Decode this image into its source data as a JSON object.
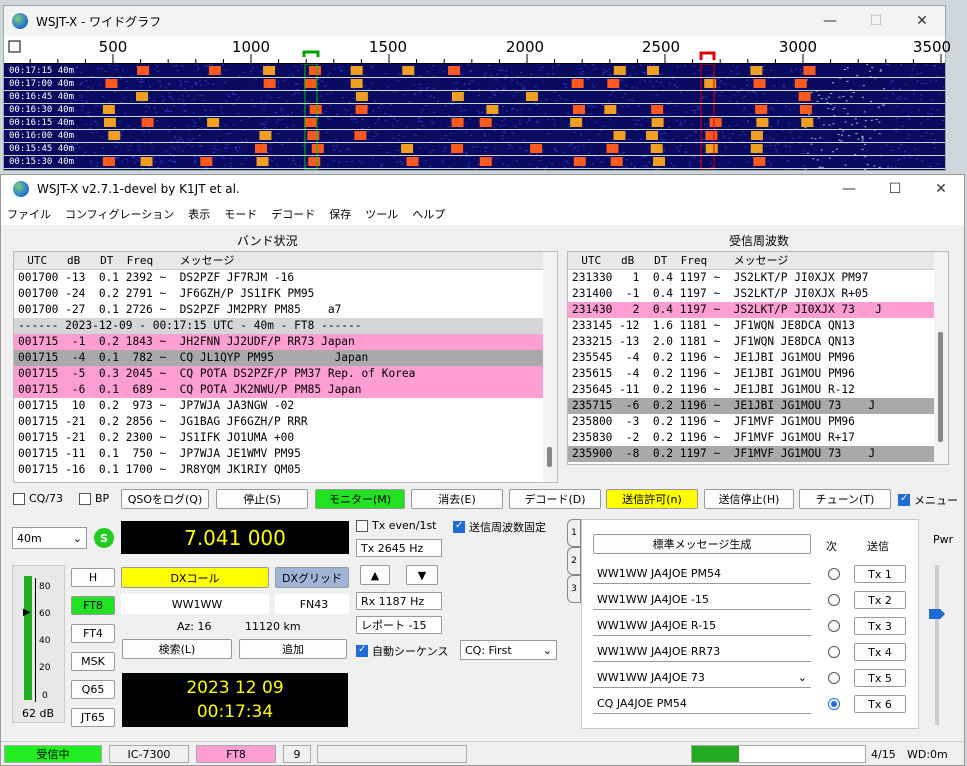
{
  "widegraph": {
    "title": "WSJT-X - ワイドグラフ",
    "scale_labels": [
      "500",
      "1000",
      "1500",
      "2000",
      "2500",
      "3000",
      "3500"
    ],
    "time_rows": [
      {
        "utc": "00:17:15",
        "band": "40m"
      },
      {
        "utc": "00:17:00",
        "band": "40m"
      },
      {
        "utc": "00:16:45",
        "band": "40m"
      },
      {
        "utc": "00:16:30",
        "band": "40m"
      },
      {
        "utc": "00:16:15",
        "band": "40m"
      },
      {
        "utc": "00:16:00",
        "band": "40m"
      },
      {
        "utc": "00:15:45",
        "band": "40m"
      },
      {
        "utc": "00:15:30",
        "band": "40m"
      }
    ]
  },
  "main": {
    "title": "WSJT-X   v2.7.1-devel   by K1JT et al.",
    "menu": [
      "ファイル",
      "コンフィグレーション",
      "表示",
      "モード",
      "デコード",
      "保存",
      "ツール",
      "ヘルプ"
    ],
    "band_activity": {
      "title": "バンド状況",
      "header": "  UTC   dB   DT  Freq    メッセージ",
      "lines": [
        {
          "text": "001700 -13  0.1 2392 ~  DS2PZF JF7RJM -16",
          "style": ""
        },
        {
          "text": "001700 -24  0.2 2791 ~  JF6GZH/P JS1IFK PM95",
          "style": ""
        },
        {
          "text": "001700 -27  0.1 2726 ~  DS2PZF JM2PRY PM85    a7",
          "style": ""
        },
        {
          "text": "------ 2023-12-09 - 00:17:15 UTC - 40m - FT8 ------",
          "style": "sep"
        },
        {
          "text": "001715  -1  0.2 1843 ~  JH2FNN JJ2UDF/P RR73 Japan",
          "style": "pink"
        },
        {
          "text": "001715  -4  0.1  782 ~  CQ JL1QYP PM95         Japan",
          "style": "gray"
        },
        {
          "text": "001715  -5  0.3 2045 ~  CQ POTA DS2PZF/P PM37 Rep. of Korea",
          "style": "pink"
        },
        {
          "text": "001715  -6  0.1  689 ~  CQ POTA JK2NWU/P PM85 Japan",
          "style": "pink"
        },
        {
          "text": "001715  10  0.2  973 ~  JP7WJA JA3NGW -02",
          "style": ""
        },
        {
          "text": "001715 -21  0.2 2856 ~  JG1BAG JF6GZH/P RRR",
          "style": ""
        },
        {
          "text": "001715 -21  0.2 2300 ~  JS1IFK JO1UMA +00",
          "style": ""
        },
        {
          "text": "001715 -11  0.1  750 ~  JP7WJA JE1WMV PM95",
          "style": ""
        },
        {
          "text": "001715 -16  0.1 1700 ~  JR8YQM JK1RIY QM05",
          "style": ""
        }
      ]
    },
    "rx_frequency": {
      "title": "受信周波数",
      "header": "  UTC   dB   DT  Freq    メッセージ",
      "lines": [
        {
          "text": "231330   1  0.4 1197 ~  JS2LKT/P JI0XJX PM97",
          "style": ""
        },
        {
          "text": "231400  -1  0.4 1197 ~  JS2LKT/P JI0XJX R+05",
          "style": ""
        },
        {
          "text": "231430   2  0.4 1197 ~  JS2LKT/P JI0XJX 73   J",
          "style": "pink"
        },
        {
          "text": "233145 -12  1.6 1181 ~  JF1WQN JE8DCA QN13",
          "style": ""
        },
        {
          "text": "233215 -13  2.0 1181 ~  JF1WQN JE8DCA QN13",
          "style": ""
        },
        {
          "text": "235545  -4  0.2 1196 ~  JE1JBI JG1MOU PM96",
          "style": ""
        },
        {
          "text": "235615  -4  0.2 1196 ~  JE1JBI JG1MOU PM96",
          "style": ""
        },
        {
          "text": "235645 -11  0.2 1196 ~  JE1JBI JG1MOU R-12",
          "style": ""
        },
        {
          "text": "235715  -6  0.2 1196 ~  JE1JBI JG1MOU 73    J",
          "style": "gray"
        },
        {
          "text": "235800  -3  0.2 1196 ~  JF1MVF JG1MOU PM96",
          "style": ""
        },
        {
          "text": "235830  -2  0.2 1196 ~  JF1MVF JG1MOU R+17",
          "style": ""
        },
        {
          "text": "235900  -8  0.2 1197 ~  JF1MVF JG1MOU 73    J",
          "style": "gray"
        }
      ]
    },
    "controls": {
      "cq73": "CQ/73",
      "bp": "BP",
      "log_qso": "QSOをログ(Q)",
      "stop": "停止(S)",
      "monitor": "モニター(M)",
      "erase": "消去(E)",
      "decode": "デコード(D)",
      "enable_tx": "送信許可(n)",
      "halt_tx": "送信停止(H)",
      "tune": "チューン(T)",
      "menus": "メニュー"
    },
    "band_select": "40m",
    "frequency": "7.041 000",
    "tx_even": "Tx even/1st",
    "hold_tx_freq": "送信周波数固定",
    "tx_freq": "Tx  2645  Hz",
    "rx_freq": "Rx  1187  Hz",
    "report": "レポート -15",
    "auto_seq": "自動シーケンス",
    "cq_option": "CQ: First",
    "dx_call_label": "DXコール",
    "dx_grid_label": "DXグリッド",
    "dx_call": "WW1WW",
    "dx_grid": "FN43",
    "az": "Az: 16",
    "dist": "11120 km",
    "lookup": "検索(L)",
    "add": "追加",
    "date": "2023 12 09",
    "time": "00:17:34",
    "modes": [
      "H",
      "FT8",
      "FT4",
      "MSK",
      "Q65",
      "JT65"
    ],
    "meter_ticks": [
      "80",
      "60",
      "40",
      "20",
      "0"
    ],
    "meter_db": "62 dB",
    "meter_level": 0.62,
    "tabs": [
      "1",
      "2",
      "3"
    ],
    "gen_std": "標準メッセージ生成",
    "next": "次",
    "send": "送信",
    "tx_msgs": [
      {
        "msg": "WW1WW JA4JOE PM54",
        "btn": "Tx 1"
      },
      {
        "msg": "WW1WW JA4JOE -15",
        "btn": "Tx 2"
      },
      {
        "msg": "WW1WW JA4JOE R-15",
        "btn": "Tx 3"
      },
      {
        "msg": "WW1WW JA4JOE RR73",
        "btn": "Tx 4"
      },
      {
        "msg": "WW1WW JA4JOE 73",
        "btn": "Tx 5"
      },
      {
        "msg": "CQ JA4JOE PM54",
        "btn": "Tx 6"
      }
    ],
    "pwr": "Pwr",
    "s_btn": "S",
    "status": {
      "state": "受信中",
      "rig": "IC-7300",
      "mode": "FT8",
      "tr": "9",
      "progress": "4/15",
      "wd": "WD:0m",
      "progress_fill": 0.27
    },
    "colors": {
      "monitor": "#22e022",
      "enable_tx": "#ffff00",
      "freq_bg": "#000000",
      "freq_fg": "#ffff00",
      "pink": "#ff9ed2"
    }
  }
}
